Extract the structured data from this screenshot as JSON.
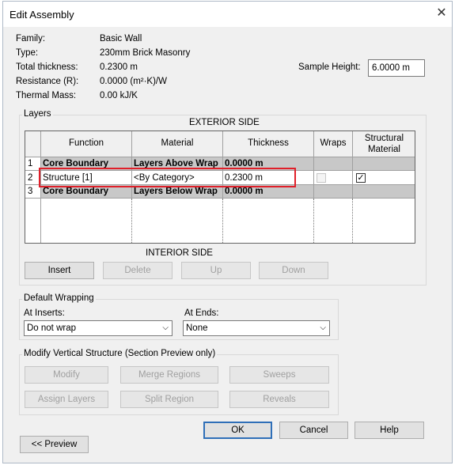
{
  "window": {
    "title": "Edit Assembly",
    "close": "✕"
  },
  "properties": {
    "family_label": "Family:",
    "family_value": "Basic Wall",
    "type_label": "Type:",
    "type_value": "230mm Brick Masonry",
    "thickness_label": "Total thickness:",
    "thickness_value": "0.2300 m",
    "resistance_label": "Resistance (R):",
    "resistance_value": "0.0000 (m²·K)/W",
    "mass_label": "Thermal Mass:",
    "mass_value": "0.00 kJ/K",
    "sample_height_label": "Sample Height:",
    "sample_height_value": "6.0000 m"
  },
  "layers": {
    "group_title": "Layers",
    "exterior": "EXTERIOR SIDE",
    "interior": "INTERIOR SIDE",
    "columns": [
      "Function",
      "Material",
      "Thickness",
      "Wraps",
      "Structural\nMaterial"
    ],
    "rows": [
      {
        "num": "1",
        "function": "Core Boundary",
        "material": "Layers Above Wrap",
        "thickness": "0.0000 m",
        "wraps": null,
        "structural": null
      },
      {
        "num": "2",
        "function": "Structure [1]",
        "material": "<By Category>",
        "thickness": "0.2300 m",
        "wraps": false,
        "structural": true
      },
      {
        "num": "3",
        "function": "Core Boundary",
        "material": "Layers Below Wrap",
        "thickness": "0.0000 m",
        "wraps": null,
        "structural": null
      }
    ],
    "browse": "...",
    "buttons": {
      "insert": "Insert",
      "delete": "Delete",
      "up": "Up",
      "down": "Down"
    }
  },
  "wrapping": {
    "group_title": "Default Wrapping",
    "inserts_label": "At Inserts:",
    "inserts_value": "Do not wrap",
    "ends_label": "At Ends:",
    "ends_value": "None"
  },
  "modify": {
    "group_title": "Modify Vertical Structure (Section Preview only)",
    "buttons": {
      "modify": "Modify",
      "merge": "Merge Regions",
      "sweeps": "Sweeps",
      "assign": "Assign Layers",
      "split": "Split Region",
      "reveals": "Reveals"
    }
  },
  "footer": {
    "ok": "OK",
    "cancel": "Cancel",
    "help": "Help",
    "preview": "<< Preview"
  }
}
